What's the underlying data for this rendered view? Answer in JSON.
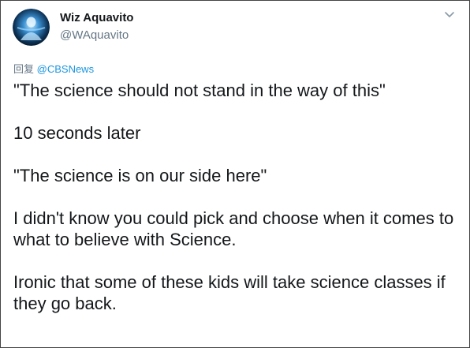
{
  "author": {
    "name": "Wiz Aquavito",
    "handle": "@WAquavito"
  },
  "reply": {
    "label": "回复",
    "mention": "@CBSNews"
  },
  "paragraphs": [
    "\"The science should not stand in the way of this\"",
    "10 seconds later",
    "\"The science is on our side here\"",
    "I didn't know you could pick and choose when it comes to what to believe with Science.",
    "Ironic that some of these kids will take science classes if they go back."
  ],
  "icons": {
    "avatar": "avatar-glowing-figure",
    "menu": "chevron-down-icon"
  },
  "colors": {
    "name": "#14171a",
    "secondary": "#657786",
    "mention": "#1b95e0",
    "border": "#444444"
  }
}
